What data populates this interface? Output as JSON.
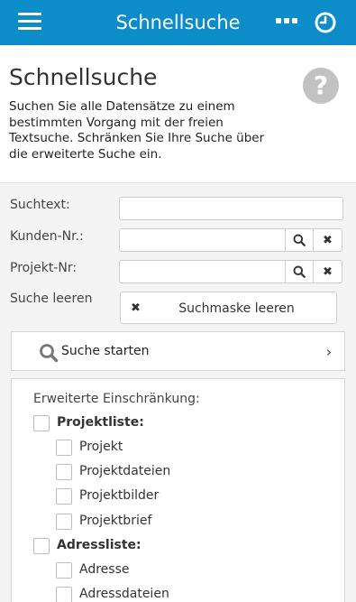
{
  "header": {
    "title": "Schnellsuche",
    "menu_icon": "hamburger-menu-icon",
    "more_icon": "ellipsis-icon",
    "history_icon": "clock-icon",
    "background_color": "#0c8cc9"
  },
  "page": {
    "title": "Schnellsuche",
    "help_icon_glyph": "?",
    "intro": "Suchen Sie alle Datensätze zu einem bestimmten Vorgang mit der freien Textsuche. Schränken Sie Ihre Suche über die erweiterte Suche ein."
  },
  "form": {
    "suchtext": {
      "label": "Suchtext:",
      "value": "",
      "placeholder": ""
    },
    "kunden_nr": {
      "label": "Kunden-Nr.:",
      "value": "",
      "placeholder": ""
    },
    "projekt_nr": {
      "label": "Projekt-Nr:",
      "value": "",
      "placeholder": ""
    },
    "clear": {
      "label": "Suche leeren",
      "button_label": "Suchmaske leeren"
    },
    "search_icon": "search-icon",
    "clear_icon": "close-icon"
  },
  "search_start": {
    "label": "Suche starten",
    "chevron": "›"
  },
  "extended": {
    "title": "Erweiterte Einschränkung:",
    "groups": [
      {
        "label": "Projektliste:",
        "checked": false,
        "items": [
          {
            "label": "Projekt",
            "checked": false
          },
          {
            "label": "Projektdateien",
            "checked": false
          },
          {
            "label": "Projektbilder",
            "checked": false
          },
          {
            "label": "Projektbrief",
            "checked": false
          }
        ]
      },
      {
        "label": "Adressliste:",
        "checked": false,
        "items": [
          {
            "label": "Adresse",
            "checked": false
          },
          {
            "label": "Adressdateien",
            "checked": false
          }
        ]
      }
    ]
  }
}
